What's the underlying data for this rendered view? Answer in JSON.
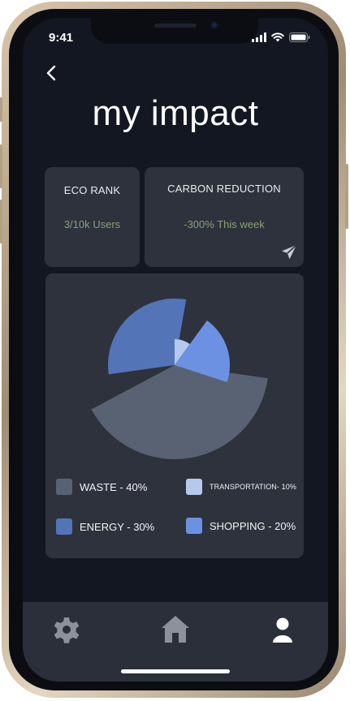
{
  "status_bar": {
    "time": "9:41"
  },
  "header": {
    "title": "my impact"
  },
  "stats": {
    "eco_rank": {
      "title": "ECO RANK",
      "value": "3/10k Users"
    },
    "carbon_reduction": {
      "title": "CARBON REDUCTION",
      "value": "-300% This week"
    }
  },
  "chart_data": {
    "type": "pie",
    "categories": [
      "WASTE",
      "ENERGY",
      "TRANSPORTATION",
      "SHOPPING"
    ],
    "values": [
      40,
      30,
      10,
      20
    ],
    "colors": [
      "#596273",
      "#5474b8",
      "#b7c8ee",
      "#6d91e2"
    ]
  },
  "legend": {
    "waste": "WASTE - 40%",
    "transportation": "TRANSPORTATION- 10%",
    "energy": "ENERGY - 30%",
    "shopping": "SHOPPING - 20%"
  },
  "icons": {
    "back": "chevron-left-icon",
    "share": "send-icon",
    "settings": "gear-icon",
    "home": "home-icon",
    "profile": "user-icon"
  },
  "colors": {
    "background": "#121722",
    "card": "#2d323c",
    "accent_value": "#8aa172",
    "tab_bar": "#2a2f39"
  }
}
